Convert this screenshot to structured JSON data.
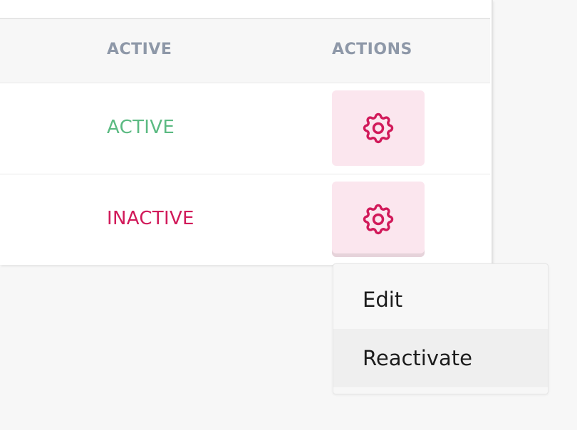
{
  "table": {
    "headers": {
      "active": "ACTIVE",
      "actions": "ACTIONS"
    },
    "rows": [
      {
        "status": "ACTIVE",
        "status_color": "#5bba82",
        "action_icon": "gear-icon"
      },
      {
        "status": "INACTIVE",
        "status_color": "#d11a5a",
        "action_icon": "gear-icon"
      }
    ]
  },
  "dropdown": {
    "items": [
      {
        "label": "Edit"
      },
      {
        "label": "Reactivate",
        "highlighted": true
      }
    ]
  },
  "colors": {
    "accent": "#d11a5a",
    "accent_bg": "#fbe6ee",
    "active": "#5bba82",
    "header_text": "#8e98a8"
  }
}
